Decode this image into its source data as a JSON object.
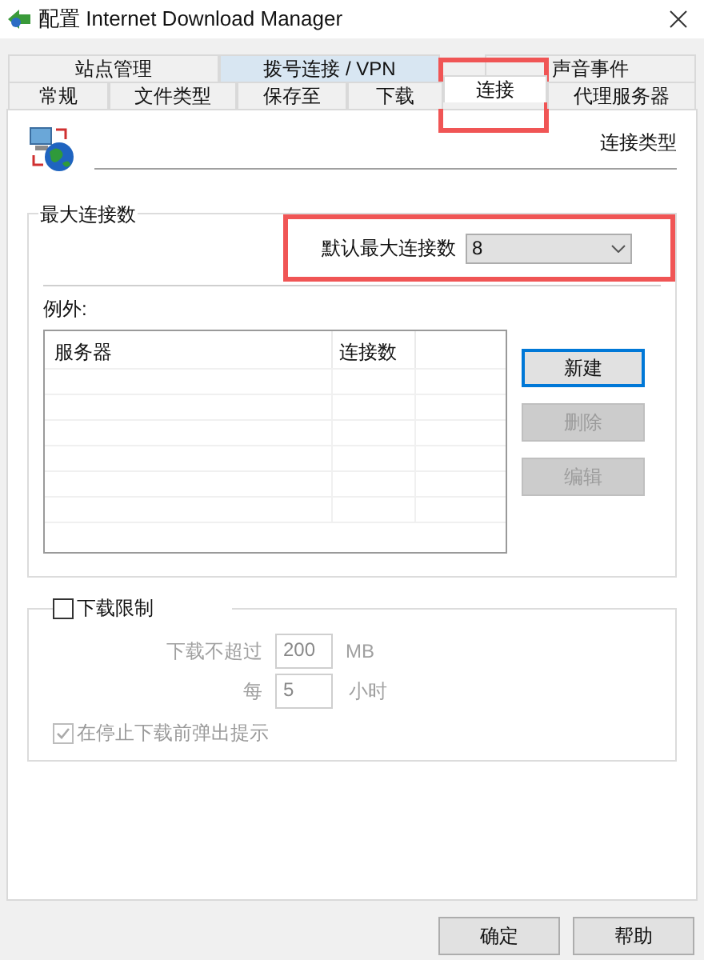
{
  "window": {
    "title": "配置 Internet Download Manager"
  },
  "tabs_row_1": [
    {
      "label": "站点管理",
      "selected": false,
      "hovered": false
    },
    {
      "label": "拨号连接 / VPN",
      "selected": false,
      "hovered": true
    },
    {
      "label": "声音事件",
      "selected": false,
      "hovered": false
    }
  ],
  "tabs_row_2": [
    {
      "label": "常规",
      "selected": false,
      "highlighted": false
    },
    {
      "label": "文件类型",
      "selected": false,
      "highlighted": false
    },
    {
      "label": "保存至",
      "selected": false,
      "highlighted": false
    },
    {
      "label": "下载",
      "selected": false,
      "highlighted": false
    },
    {
      "label": "连接",
      "selected": true,
      "highlighted": true
    },
    {
      "label": "代理服务器",
      "selected": false,
      "highlighted": false
    }
  ],
  "section_label": "连接类型",
  "max_connections": {
    "title": "最大连接数",
    "default_label": "默认最大连接数",
    "default_value": "8",
    "highlighted": true
  },
  "exceptions": {
    "label": "例外:",
    "columns": [
      "服务器",
      "连接数"
    ],
    "buttons": [
      {
        "label": "新建",
        "disabled": false,
        "focused": true
      },
      {
        "label": "删除",
        "disabled": true,
        "focused": false
      },
      {
        "label": "编辑",
        "disabled": true,
        "focused": false
      }
    ]
  },
  "download_limit": {
    "label": "下载限制",
    "checked": false,
    "limit_label": "下载不超过",
    "limit_value": "200",
    "limit_unit": "MB",
    "per_label": "每",
    "per_value": "5",
    "per_unit": "小时",
    "prompt": {
      "label": "在停止下载前弹出提示",
      "checked": true,
      "disabled": true
    }
  },
  "buttons": [
    {
      "label": "确定"
    },
    {
      "label": "帮助"
    }
  ]
}
